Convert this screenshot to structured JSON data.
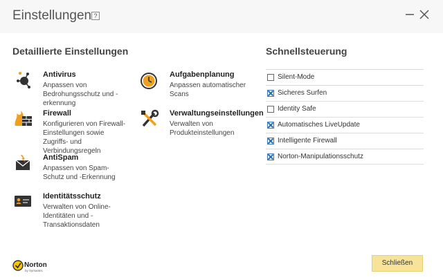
{
  "window": {
    "title": "Einstellungen",
    "help_label": "?",
    "minimize_icon": "minimize-icon",
    "close_icon": "close-icon"
  },
  "detailed": {
    "heading": "Detaillierte Einstellungen",
    "items": [
      {
        "name": "Antivirus",
        "desc": "Anpassen von Bedrohungsschutz und -erkennung",
        "icon": "antivirus-icon"
      },
      {
        "name": "Firewall",
        "desc": "Konfigurieren von Firewall-Einstellungen sowie Zugriffs- und Verbindungsregeln",
        "icon": "firewall-icon"
      },
      {
        "name": "AntiSpam",
        "desc": "Anpassen von Spam-Schutz und -Erkennung",
        "icon": "antispam-icon"
      },
      {
        "name": "Identitätsschutz",
        "desc": "Verwalten von Online-Identitäten und -Transaktionsdaten",
        "icon": "identity-card-icon"
      },
      {
        "name": "Aufgabenplanung",
        "desc": "Anpassen automatischer Scans",
        "icon": "clock-icon"
      },
      {
        "name": "Verwaltungseinstellungen",
        "desc": "Verwalten von Produkteinstellungen",
        "icon": "tools-icon"
      }
    ]
  },
  "quick": {
    "heading": "Schnellsteuerung",
    "items": [
      {
        "label": "Silent-Mode",
        "checked": false
      },
      {
        "label": "Sicheres Surfen",
        "checked": true
      },
      {
        "label": "Identity Safe",
        "checked": false
      },
      {
        "label": "Automatisches LiveUpdate",
        "checked": true
      },
      {
        "label": "Intelligente Firewall",
        "checked": true
      },
      {
        "label": "Norton-Manipulationsschutz",
        "checked": true
      }
    ]
  },
  "footer": {
    "logo_text": "Norton",
    "logo_sub": "by Symantec",
    "close_label": "Schließen"
  },
  "colors": {
    "accent_yellow": "#f7e39a",
    "checkbox_blue": "#2a6db0",
    "icon_dark": "#333333",
    "firewall_orange": "#f0a020"
  }
}
